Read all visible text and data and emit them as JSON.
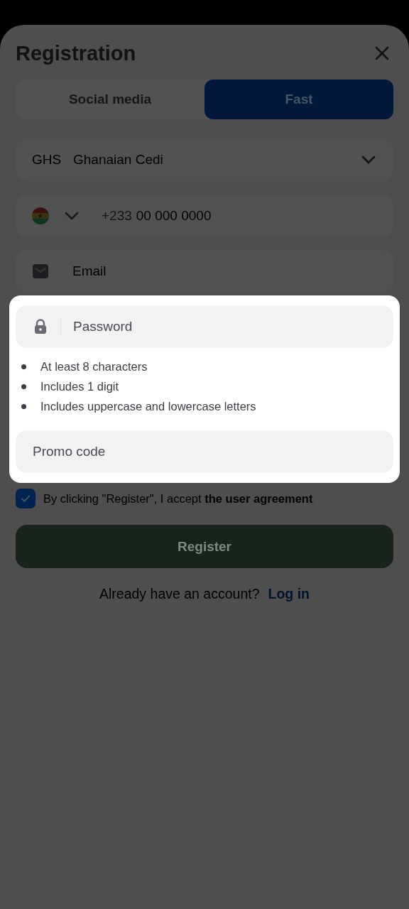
{
  "title": "Registration",
  "tabs": [
    {
      "label": "Social media",
      "selected": false
    },
    {
      "label": "Fast",
      "selected": true
    }
  ],
  "currency": {
    "code": "GHS",
    "name": "Ghanaian Cedi"
  },
  "phone": {
    "prefix": "+233",
    "placeholder": "00 000 0000"
  },
  "email": {
    "placeholder": "Email"
  },
  "password": {
    "placeholder": "Password"
  },
  "password_rules": [
    "At least 8 characters",
    "Includes 1 digit",
    "Includes uppercase and lowercase letters"
  ],
  "promo": {
    "placeholder": "Promo code"
  },
  "agreement": {
    "checked": true,
    "text": "By clicking \"Register\", I accept **the user agreement**"
  },
  "register_button": "Register",
  "login_prompt": {
    "text": "Already have an account?",
    "link": "Log in"
  }
}
